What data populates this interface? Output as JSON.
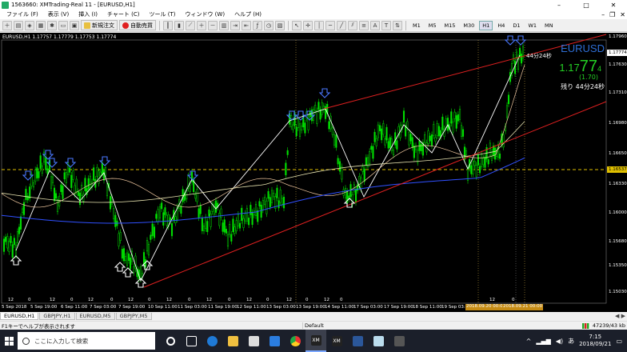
{
  "window": {
    "title": "1563660: XMTrading-Real 11 - [EURUSD,H1]",
    "controls": [
      "–",
      "□",
      "✕"
    ]
  },
  "menu": {
    "items": [
      "ファイル (F)",
      "表示 (V)",
      "挿入 (I)",
      "チャート (C)",
      "ツール (T)",
      "ウィンドウ (W)",
      "ヘルプ (H)"
    ],
    "mdi_controls": [
      "–",
      "❐",
      "✕"
    ]
  },
  "toolbar": {
    "new_order_label": "新規注文",
    "auto_trade_label": "自動売買",
    "timeframes": [
      "M1",
      "M5",
      "M15",
      "M30",
      "H1",
      "H4",
      "D1",
      "W1",
      "MN"
    ],
    "active_timeframe": "H1"
  },
  "chart": {
    "header": "EURUSD,H1  1.17757 1.17779 1.17753 1.17774",
    "symbol": "EURUSD",
    "bid_part1": "1.17",
    "bid_part2": "77",
    "bid_part3": "4",
    "spread": "(1.70)",
    "remaining": "残り 44分24秒",
    "remaining_small": "44分24秒",
    "price_ticks": [
      "1.17960",
      "1.17630",
      "1.17310",
      "1.16980",
      "1.16650",
      "1.16330",
      "1.16000",
      "1.15680",
      "1.15350",
      "1.15030"
    ],
    "current_price": "1.17774",
    "line_price": "1.16537",
    "time_labels": [
      "5 Sep 2018",
      "5 Sep 19:00",
      "6 Sep 11:00",
      "7 Sep 03:00",
      "7 Sep 19:00",
      "10 Sep 11:00",
      "11 Sep 03:00",
      "11 Sep 19:00",
      "12 Sep 11:00",
      "13 Sep 03:00",
      "13 Sep 19:00",
      "14 Sep 11:00",
      "17 Sep 03:00",
      "17 Sep 19:00",
      "18 Sep 11:00",
      "19 Sep 03:00"
    ],
    "time_highlight_1": "2018.09.20 00:00",
    "time_highlight_2": "2018.09.21 00:00",
    "hour_labels": [
      "12",
      "0",
      "12",
      "0",
      "12",
      "0",
      "12",
      "0",
      "12",
      "0",
      "12",
      "0",
      "12",
      "0",
      "12",
      "0",
      "12",
      "0",
      "12",
      "0"
    ],
    "colors": {
      "bull": "#00e000",
      "bear": "#00e000",
      "channel": "#e02020",
      "ma_fast": "#f0c8a0",
      "ma_slow": "#e8e4b0",
      "ma_blue": "#3050ff",
      "arrows": "#4a78ff",
      "hline": "#e0c000"
    }
  },
  "tabs": {
    "items": [
      "EURUSD,H1",
      "GBPJPY,H1",
      "EURUSD,M5",
      "GBPJPY,M5"
    ],
    "active": 0
  },
  "statusbar": {
    "help": "F1キーでヘルプが表示されます",
    "profile": "Default",
    "connection": "47239/43 kb"
  },
  "taskbar": {
    "search_placeholder": "ここに入力して検索",
    "time": "7:15",
    "date": "2018/09/21"
  }
}
